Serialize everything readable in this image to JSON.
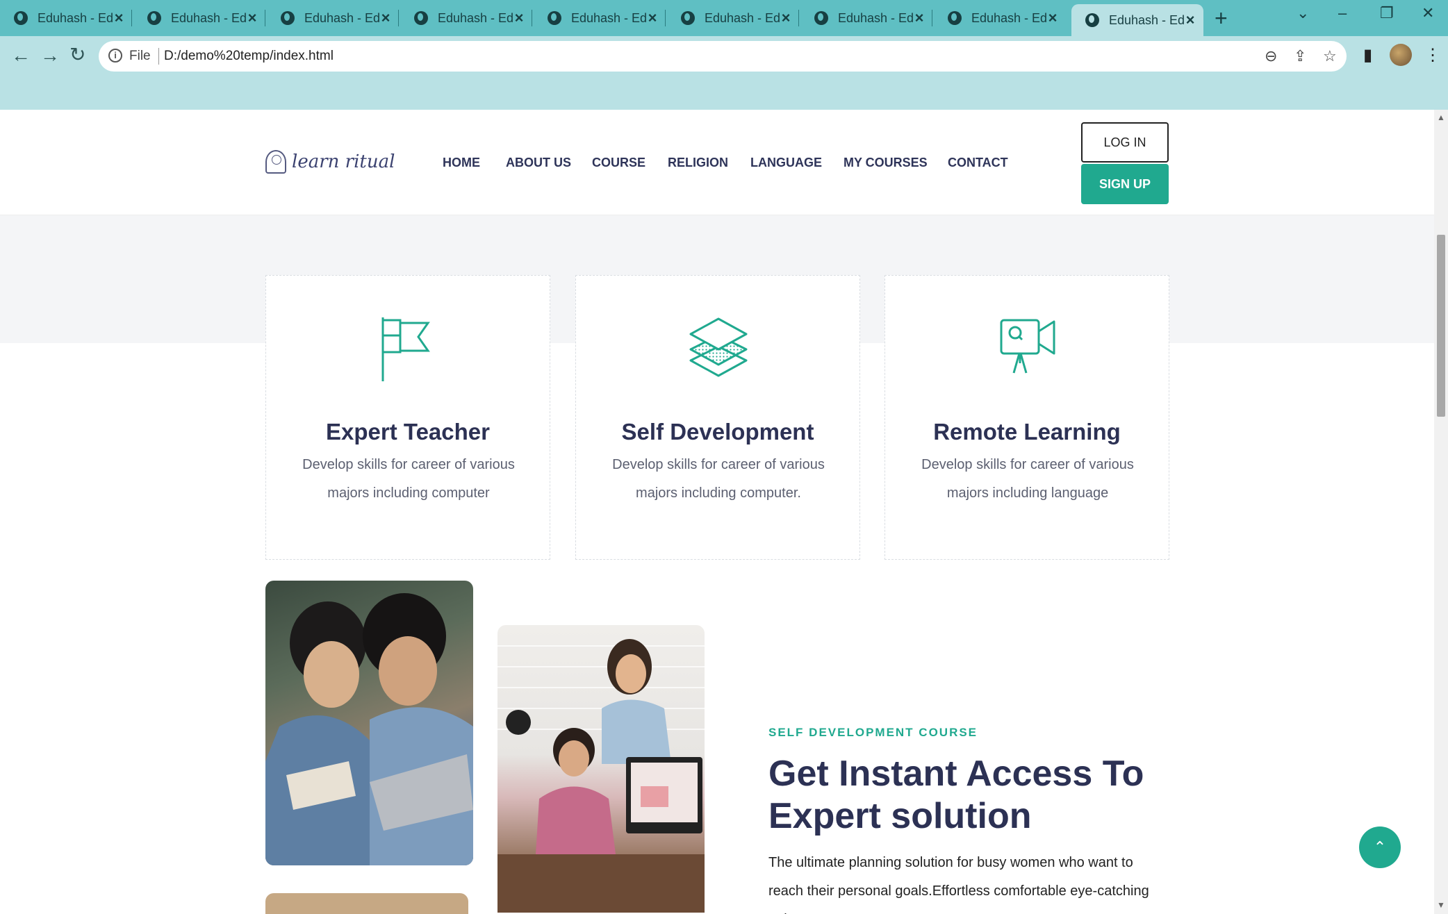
{
  "browser": {
    "tabs": [
      {
        "title": "Eduhash - Educ"
      },
      {
        "title": "Eduhash - Educ"
      },
      {
        "title": "Eduhash - Educ"
      },
      {
        "title": "Eduhash - Educ"
      },
      {
        "title": "Eduhash - Educ"
      },
      {
        "title": "Eduhash - Educ"
      },
      {
        "title": "Eduhash - Educ"
      },
      {
        "title": "Eduhash - Educ"
      },
      {
        "title": "Eduhash - Educ"
      }
    ],
    "new_tab": "+",
    "omnibox": {
      "scheme_label": "File",
      "url": "D:/demo%20temp/index.html"
    },
    "colors": {
      "tabbar": "#5fbfc3",
      "toolbar": "#b9e1e4"
    }
  },
  "site": {
    "logo_text": "learn ritual",
    "nav": [
      "HOME",
      "ABOUT US",
      "COURSE",
      "RELIGION",
      "LANGUAGE",
      "MY COURSES",
      "CONTACT"
    ],
    "login_label": "LOG IN",
    "signup_label": "SIGN UP",
    "accent_color": "#20a98f",
    "features": [
      {
        "icon": "flag-icon",
        "title": "Expert Teacher",
        "desc": "Develop skills for career of various majors including computer"
      },
      {
        "icon": "layers-icon",
        "title": "Self Development",
        "desc": "Develop skills for career of various majors including computer."
      },
      {
        "icon": "video-camera-icon",
        "title": "Remote Learning",
        "desc": "Develop skills for career of various majors including language"
      }
    ],
    "about": {
      "eyebrow": "SELF DEVELOPMENT COURSE",
      "headline": "Get Instant Access To Expert solution",
      "body": "The ultimate planning solution for busy women who want to reach their personal goals.Effortless comfortable eye-catching unique"
    },
    "scroll_top_icon": "chevron-up-icon"
  }
}
